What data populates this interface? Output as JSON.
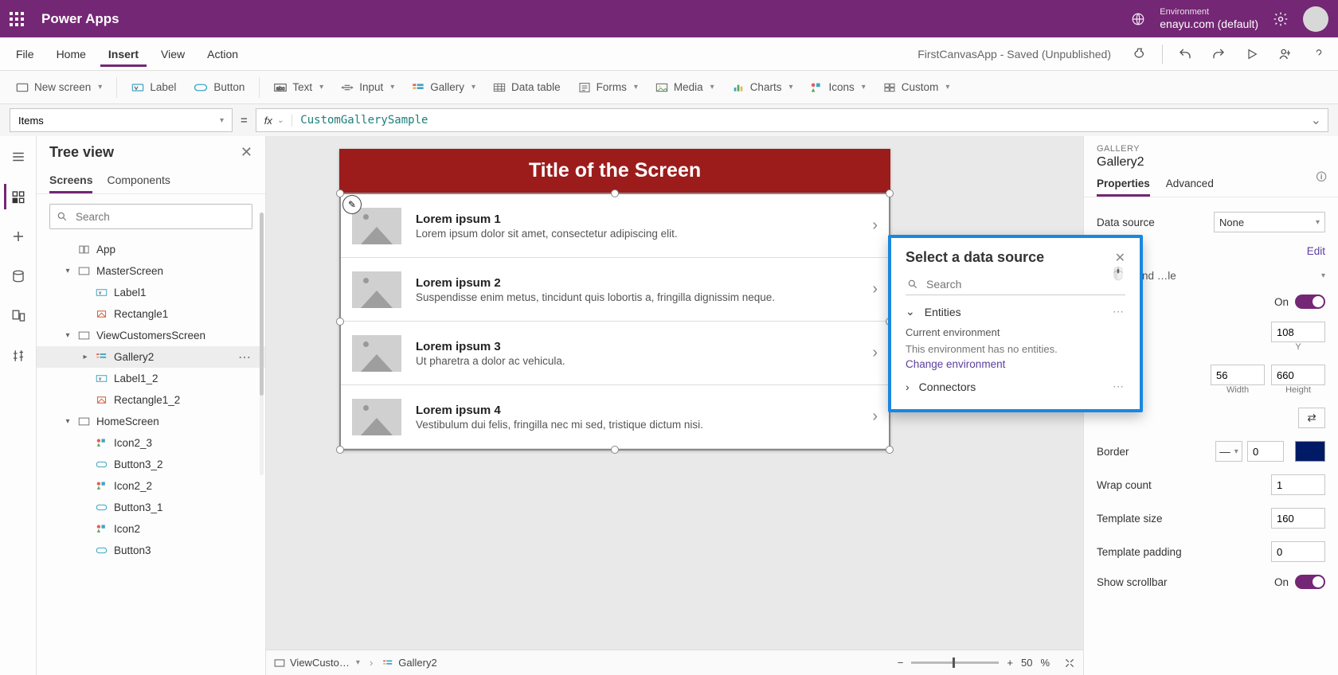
{
  "titlebar": {
    "app_name": "Power Apps",
    "env_label": "Environment",
    "env_name": "enayu.com (default)"
  },
  "menubar": {
    "items": [
      "File",
      "Home",
      "Insert",
      "View",
      "Action"
    ],
    "active_index": 2,
    "status": "FirstCanvasApp - Saved (Unpublished)"
  },
  "ribbon": {
    "new_screen": "New screen",
    "label": "Label",
    "button": "Button",
    "text": "Text",
    "input": "Input",
    "gallery": "Gallery",
    "data_table": "Data table",
    "forms": "Forms",
    "media": "Media",
    "charts": "Charts",
    "icons": "Icons",
    "custom": "Custom"
  },
  "formula": {
    "property": "Items",
    "value": "CustomGallerySample"
  },
  "tree": {
    "title": "Tree view",
    "tabs": [
      "Screens",
      "Components"
    ],
    "active_tab": 0,
    "search_placeholder": "Search",
    "nodes": [
      {
        "level": 1,
        "expand": "",
        "icon": "app",
        "label": "App"
      },
      {
        "level": 1,
        "expand": "▾",
        "icon": "screen",
        "label": "MasterScreen"
      },
      {
        "level": 2,
        "expand": "",
        "icon": "label",
        "label": "Label1"
      },
      {
        "level": 2,
        "expand": "",
        "icon": "rect",
        "label": "Rectangle1"
      },
      {
        "level": 1,
        "expand": "▾",
        "icon": "screen",
        "label": "ViewCustomersScreen"
      },
      {
        "level": 2,
        "expand": "▸",
        "icon": "gallery",
        "label": "Gallery2",
        "selected": true
      },
      {
        "level": 2,
        "expand": "",
        "icon": "label",
        "label": "Label1_2"
      },
      {
        "level": 2,
        "expand": "",
        "icon": "rect",
        "label": "Rectangle1_2"
      },
      {
        "level": 1,
        "expand": "▾",
        "icon": "screen",
        "label": "HomeScreen"
      },
      {
        "level": 2,
        "expand": "",
        "icon": "icon",
        "label": "Icon2_3"
      },
      {
        "level": 2,
        "expand": "",
        "icon": "button",
        "label": "Button3_2"
      },
      {
        "level": 2,
        "expand": "",
        "icon": "icon",
        "label": "Icon2_2"
      },
      {
        "level": 2,
        "expand": "",
        "icon": "button",
        "label": "Button3_1"
      },
      {
        "level": 2,
        "expand": "",
        "icon": "icon",
        "label": "Icon2"
      },
      {
        "level": 2,
        "expand": "",
        "icon": "button",
        "label": "Button3"
      }
    ]
  },
  "canvas": {
    "screen_title": "Title of the Screen",
    "status_screen": "ViewCusto…",
    "status_control": "Gallery2",
    "zoom_pct": "50",
    "zoom_unit": "%",
    "gallery_items": [
      {
        "title": "Lorem ipsum 1",
        "sub": "Lorem ipsum dolor sit amet, consectetur adipiscing elit."
      },
      {
        "title": "Lorem ipsum 2",
        "sub": "Suspendisse enim metus, tincidunt quis lobortis a, fringilla dignissim neque."
      },
      {
        "title": "Lorem ipsum 3",
        "sub": "Ut pharetra a dolor ac vehicula."
      },
      {
        "title": "Lorem ipsum 4",
        "sub": "Vestibulum dui felis, fringilla nec mi sed, tristique dictum nisi."
      }
    ]
  },
  "props": {
    "type_label": "GALLERY",
    "name": "Gallery2",
    "tabs": [
      "Properties",
      "Advanced"
    ],
    "active_tab": 0,
    "data_source_label": "Data source",
    "data_source_value": "None",
    "edit_label": "Edit",
    "layout_hint": "…, title, and …le",
    "visible_on": "On",
    "y_value": "108",
    "y_label": "Y",
    "width_value": "56",
    "width_label": "Width",
    "height_value": "660",
    "height_label": "Height",
    "border_label": "Border",
    "border_value": "0",
    "wrap_label": "Wrap count",
    "wrap_value": "1",
    "template_size_label": "Template size",
    "template_size_value": "160",
    "template_pad_label": "Template padding",
    "template_pad_value": "0",
    "scrollbar_label": "Show scrollbar",
    "scrollbar_on": "On"
  },
  "popup": {
    "title": "Select a data source",
    "search_placeholder": "Search",
    "sec_entities": "Entities",
    "current_env": "Current environment",
    "no_entities": "This environment has no entities.",
    "change_env": "Change environment",
    "sec_connectors": "Connectors"
  }
}
